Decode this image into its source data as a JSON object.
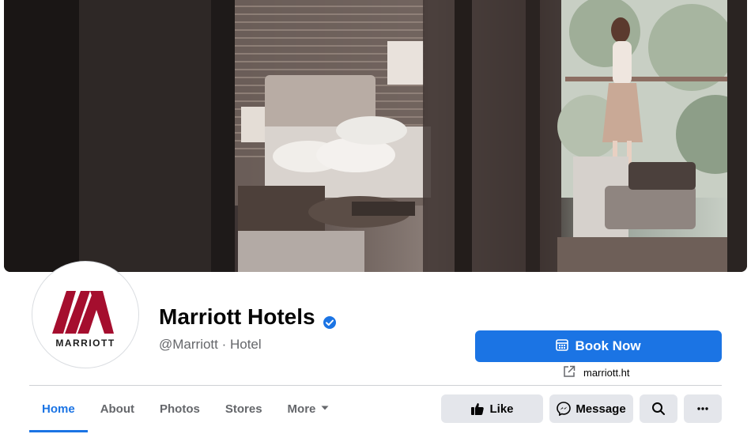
{
  "page": {
    "name": "Marriott Hotels",
    "handle": "@Marriott · Hotel",
    "logo_wordmark": "MARRIOTT"
  },
  "cta": {
    "book_label": "Book Now",
    "website": "marriott.ht"
  },
  "tabs": [
    {
      "label": "Home",
      "active": true
    },
    {
      "label": "About",
      "active": false
    },
    {
      "label": "Photos",
      "active": false
    },
    {
      "label": "Stores",
      "active": false
    },
    {
      "label": "More",
      "active": false
    }
  ],
  "actions": {
    "like_label": "Like",
    "message_label": "Message"
  },
  "colors": {
    "accent": "#1b74e4",
    "brand_red": "#a50e2e",
    "button_gray": "#e4e6eb"
  },
  "icons": {
    "verified": "verified-badge-icon",
    "calendar": "calendar-icon",
    "external": "external-link-icon",
    "like": "thumbs-up-icon",
    "message": "messenger-icon",
    "search": "search-icon",
    "more": "ellipsis-icon",
    "dropdown": "caret-down-icon"
  }
}
